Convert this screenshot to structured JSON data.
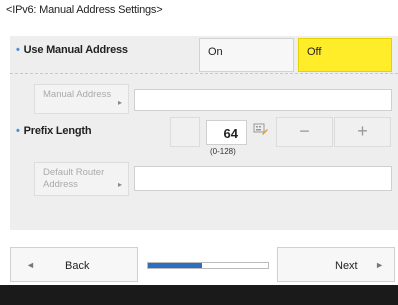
{
  "title": "<IPv6: Manual Address Settings>",
  "use_manual": {
    "label": "Use Manual Address",
    "on_label": "On",
    "off_label": "Off",
    "selected": "Off"
  },
  "manual_address": {
    "button_label": "Manual Address",
    "value": ""
  },
  "prefix": {
    "label": "Prefix Length",
    "value": "64",
    "range": "(0-128)",
    "minus": "−",
    "plus": "+"
  },
  "default_router": {
    "button_label_line1": "Default Router",
    "button_label_line2": "Address",
    "value": ""
  },
  "nav": {
    "back_label": "Back",
    "next_label": "Next",
    "progress": 0.45
  },
  "colors": {
    "selected": "#ffed2a",
    "accent": "#2c6fc0",
    "bullet": "#4a90d9"
  }
}
